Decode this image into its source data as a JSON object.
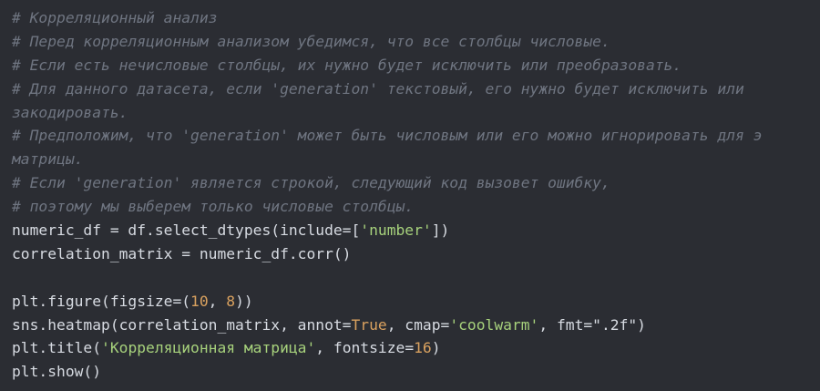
{
  "code": {
    "comment_1": "# Корреляционный анализ",
    "comment_2": "# Перед корреляционным анализом убедимся, что все столбцы числовые.",
    "comment_3": "# Если есть нечисловые столбцы, их нужно будет исключить или преобразовать.",
    "comment_4a": "# Для данного датасета, если 'generation' текстовый, его нужно будет исключить или",
    "comment_4b": "закодировать.",
    "comment_5a": "# Предположим, что 'generation' может быть числовым или его можно игнорировать для э",
    "comment_5b": "матрицы.",
    "comment_6": "# Если 'generation' является строкой, следующий код вызовет ошибку,",
    "comment_7": "# поэтому мы выберем только числовые столбцы.",
    "line_8": {
      "p1": "numeric_df = df.select_dtypes(include=[",
      "str": "'number'",
      "p2": "])"
    },
    "line_9": "correlation_matrix = numeric_df.corr()",
    "line_11": {
      "p1": "plt.figure(figsize=(",
      "n1": "10",
      "p2": ", ",
      "n2": "8",
      "p3": "))"
    },
    "line_12": {
      "p1": "sns.heatmap(correlation_matrix, annot=",
      "kw": "True",
      "p2": ", cmap=",
      "str": "'coolwarm'",
      "p3": ", fmt=\".2f\")"
    },
    "line_13": {
      "p1": "plt.title(",
      "str": "'Корреляционная матрица'",
      "p2": ", fontsize=",
      "num": "16",
      "p3": ")"
    },
    "line_14": "plt.show()"
  },
  "colors": {
    "background": "#2b2d33",
    "comment": "#6f7581",
    "text": "#d7dbe2",
    "string": "#a7d27c",
    "number": "#d9a15f"
  }
}
